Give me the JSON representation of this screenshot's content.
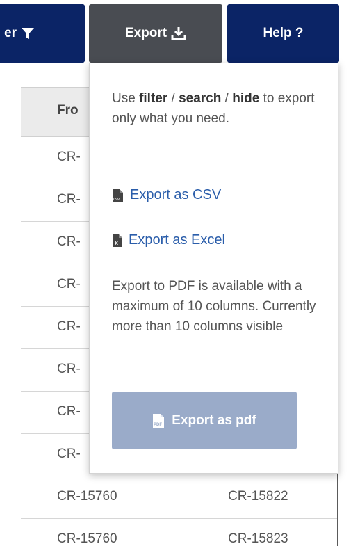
{
  "toolbar": {
    "filter_label": "er",
    "export_label": "Export",
    "help_label": "Help ?"
  },
  "table": {
    "header_from": "Fro",
    "rows": [
      {
        "c1": "CR-",
        "c2": ""
      },
      {
        "c1": "CR-",
        "c2": ""
      },
      {
        "c1": "CR-",
        "c2": ""
      },
      {
        "c1": "CR-",
        "c2": ""
      },
      {
        "c1": "CR-",
        "c2": ""
      },
      {
        "c1": "CR-",
        "c2": ""
      },
      {
        "c1": "CR-",
        "c2": ""
      },
      {
        "c1": "CR-",
        "c2": ""
      },
      {
        "c1": "CR-15760",
        "c2": "CR-15822"
      },
      {
        "c1": "CR-15760",
        "c2": "CR-15823"
      }
    ]
  },
  "export_menu": {
    "intro_use": "Use ",
    "intro_filter": "filter",
    "intro_sep1": " / ",
    "intro_search": "search",
    "intro_sep2": " / ",
    "intro_hide": "hide",
    "intro_rest": " to export only what you need.",
    "csv_label": "Export as CSV",
    "excel_label": "Export as Excel",
    "pdf_note": "Export to PDF is available with a maximum of 10 columns. Currently more than 10 columns visible",
    "pdf_button_label": "Export as pdf",
    "csv_icon_text": "csv",
    "pdf_icon_text": "PDF",
    "excel_icon_text": "x"
  },
  "colors": {
    "navy": "#0b2466",
    "export_active": "#494c52",
    "link": "#2a5daa",
    "disabled_button": "#9aabc9"
  }
}
